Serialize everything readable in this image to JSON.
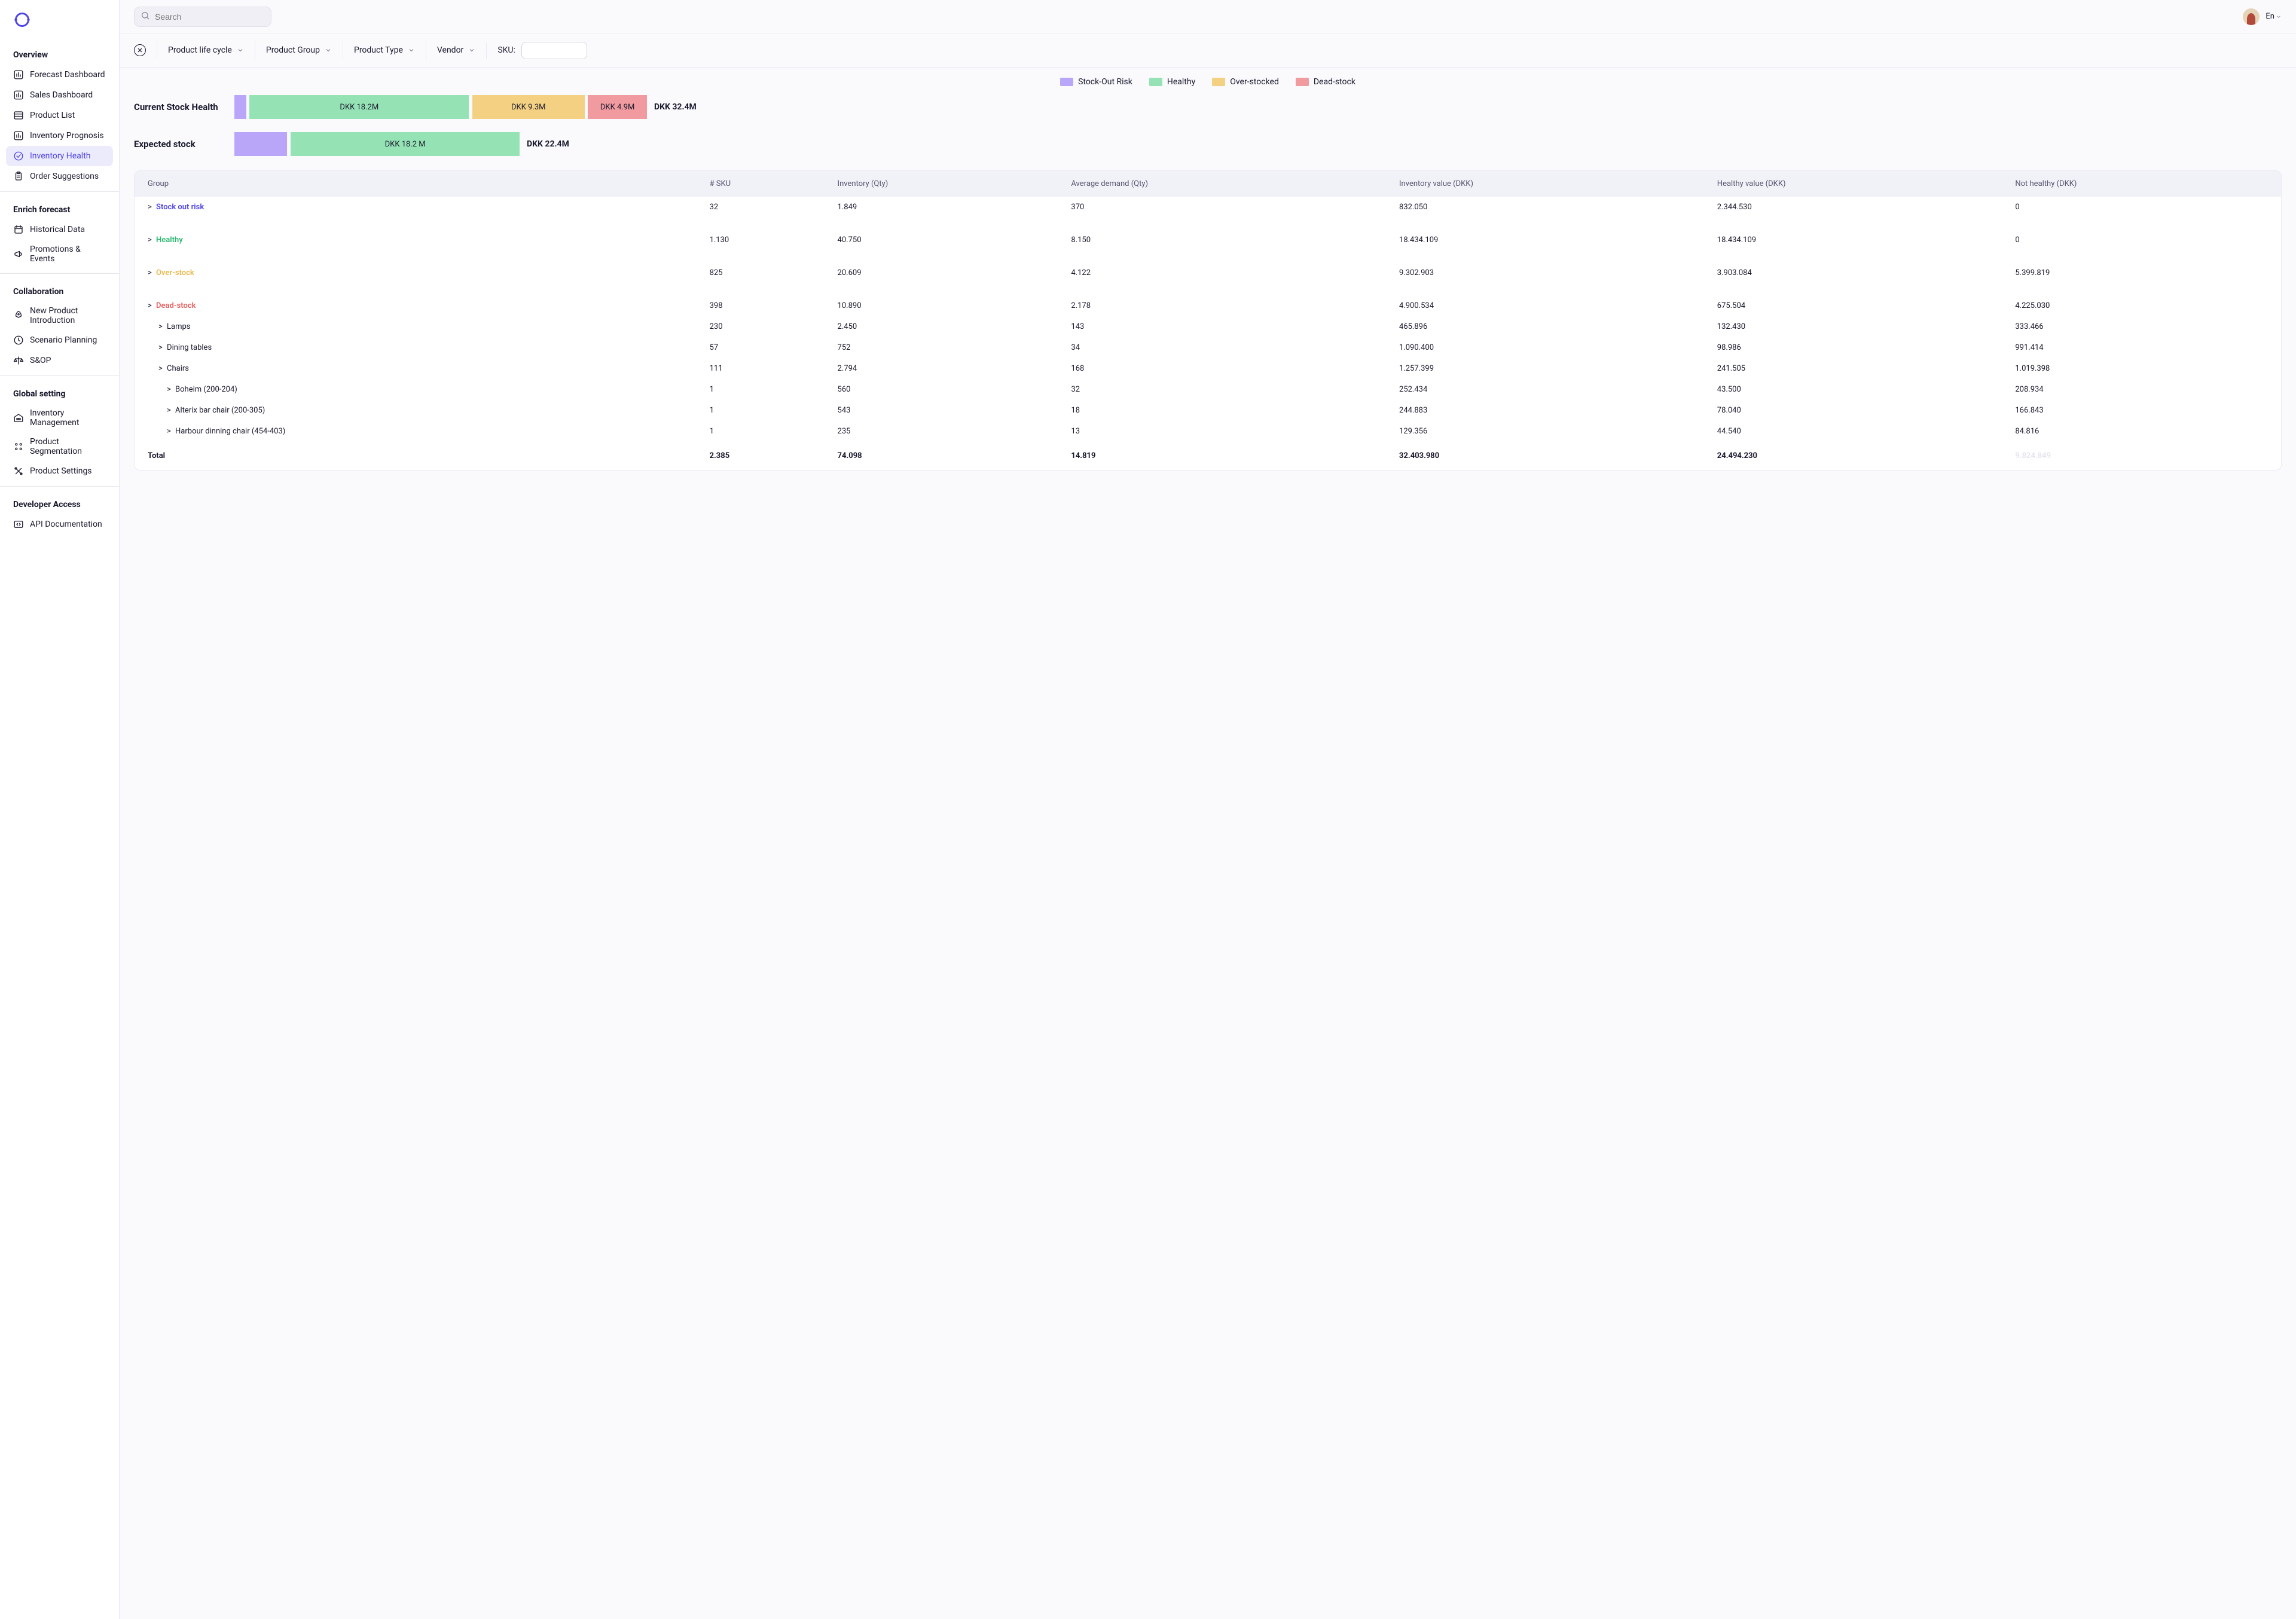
{
  "search": {
    "placeholder": "Search"
  },
  "topbar": {
    "language": "En"
  },
  "sidebar": {
    "sections": [
      {
        "title": "Overview",
        "items": [
          {
            "label": "Forecast Dashboard",
            "icon": "chart-bar-icon"
          },
          {
            "label": "Sales Dashboard",
            "icon": "chart-bar-icon"
          },
          {
            "label": "Product List",
            "icon": "list-icon"
          },
          {
            "label": "Inventory Prognosis",
            "icon": "chart-bar-icon"
          },
          {
            "label": "Inventory Health",
            "icon": "check-badge-icon",
            "active": true
          },
          {
            "label": "Order Suggestions",
            "icon": "clipboard-icon"
          }
        ]
      },
      {
        "title": "Enrich forecast",
        "items": [
          {
            "label": "Historical Data",
            "icon": "calendar-icon"
          },
          {
            "label": "Promotions & Events",
            "icon": "megaphone-icon"
          }
        ]
      },
      {
        "title": "Collaboration",
        "items": [
          {
            "label": "New Product Introduction",
            "icon": "rocket-icon"
          },
          {
            "label": "Scenario Planning",
            "icon": "clock-icon"
          },
          {
            "label": "S&OP",
            "icon": "scale-icon"
          }
        ]
      },
      {
        "title": "Global setting",
        "items": [
          {
            "label": "Inventory Management",
            "icon": "warehouse-icon"
          },
          {
            "label": "Product Segmentation",
            "icon": "grid-icon"
          },
          {
            "label": "Product Settings",
            "icon": "tools-icon"
          }
        ]
      },
      {
        "title": "Developer Access",
        "items": [
          {
            "label": "API Documentation",
            "icon": "code-icon"
          }
        ]
      }
    ]
  },
  "filters": {
    "lifecycle": "Product life cycle",
    "group": "Product Group",
    "type": "Product Type",
    "vendor": "Vendor",
    "sku_label": "SKU:"
  },
  "legend": [
    {
      "label": "Stock-Out Risk",
      "color": "#b9a6f8"
    },
    {
      "label": "Healthy",
      "color": "#95e3b5"
    },
    {
      "label": "Over-stocked",
      "color": "#f3d082"
    },
    {
      "label": "Dead-stock",
      "color": "#f19a9f"
    }
  ],
  "chart_data": [
    {
      "type": "bar",
      "title": "Current Stock Health",
      "total": "DKK 32.4M",
      "series": [
        {
          "name": "Stock-Out Risk",
          "value_m": 0.0,
          "label": "",
          "color": "#b9a6f8"
        },
        {
          "name": "Healthy",
          "value_m": 18.2,
          "label": "DKK 18.2M",
          "color": "#95e3b5"
        },
        {
          "name": "Over-stocked",
          "value_m": 9.3,
          "label": "DKK 9.3M",
          "color": "#f3d082"
        },
        {
          "name": "Dead-stock",
          "value_m": 4.9,
          "label": "DKK 4.9M",
          "color": "#f19a9f"
        }
      ],
      "total_m": 32.4,
      "unit": "DKK"
    },
    {
      "type": "bar",
      "title": "Expected stock",
      "total": "DKK 22.4M",
      "series": [
        {
          "name": "Stock-Out Risk",
          "value_m": 4.2,
          "label": "",
          "color": "#b9a6f8"
        },
        {
          "name": "Healthy",
          "value_m": 18.2,
          "label": "DKK 18.2 M",
          "color": "#95e3b5"
        }
      ],
      "total_m": 22.4,
      "unit": "DKK"
    }
  ],
  "table": {
    "columns": [
      "Group",
      "# SKU",
      "Inventory (Qty)",
      "Average demand (Qty)",
      "Inventory value (DKK)",
      "Healthy value (DKK)",
      "Not healthy (DKK)"
    ],
    "rows": [
      {
        "label": "Stock out risk",
        "class": "c-purple",
        "indent": 0,
        "sku": "32",
        "inv": "1.849",
        "avg": "370",
        "invv": "832.050",
        "hv": "2.344.530",
        "nhv": "0"
      },
      {
        "label": "Healthy",
        "class": "c-green",
        "indent": 0,
        "sku": "1.130",
        "inv": "40.750",
        "avg": "8.150",
        "invv": "18.434.109",
        "hv": "18.434.109",
        "nhv": "0"
      },
      {
        "label": "Over-stock",
        "class": "c-amber",
        "indent": 0,
        "sku": "825",
        "inv": "20.609",
        "avg": "4.122",
        "invv": "9.302.903",
        "hv": "3.903.084",
        "nhv": "5.399.819"
      },
      {
        "label": "Dead-stock",
        "class": "c-red",
        "indent": 0,
        "sku": "398",
        "inv": "10.890",
        "avg": "2.178",
        "invv": "4.900.534",
        "hv": "675.504",
        "nhv": "4.225.030"
      },
      {
        "label": "Lamps",
        "indent": 1,
        "sku": "230",
        "inv": "2.450",
        "avg": "143",
        "invv": "465.896",
        "hv": "132.430",
        "nhv": "333.466"
      },
      {
        "label": "Dining tables",
        "indent": 1,
        "sku": "57",
        "inv": "752",
        "avg": "34",
        "invv": "1.090.400",
        "hv": "98.986",
        "nhv": "991.414"
      },
      {
        "label": "Chairs",
        "indent": 1,
        "sku": "111",
        "inv": "2.794",
        "avg": "168",
        "invv": "1.257.399",
        "hv": "241.505",
        "nhv": "1.019.398"
      },
      {
        "label": "Boheim (200-204)",
        "indent": 2,
        "sku": "1",
        "inv": "560",
        "avg": "32",
        "invv": "252.434",
        "hv": "43.500",
        "nhv": "208.934"
      },
      {
        "label": "Alterix bar chair (200-305)",
        "indent": 2,
        "sku": "1",
        "inv": "543",
        "avg": "18",
        "invv": "244.883",
        "hv": "78.040",
        "nhv": "166.843"
      },
      {
        "label": "Harbour dinning chair (454-403)",
        "indent": 2,
        "sku": "1",
        "inv": "235",
        "avg": "13",
        "invv": "129.356",
        "hv": "44.540",
        "nhv": "84.816"
      }
    ],
    "total": {
      "label": "Total",
      "sku": "2.385",
      "inv": "74.098",
      "avg": "14.819",
      "invv": "32.403.980",
      "hv": "24.494.230",
      "nhv": "9.824.849"
    }
  }
}
